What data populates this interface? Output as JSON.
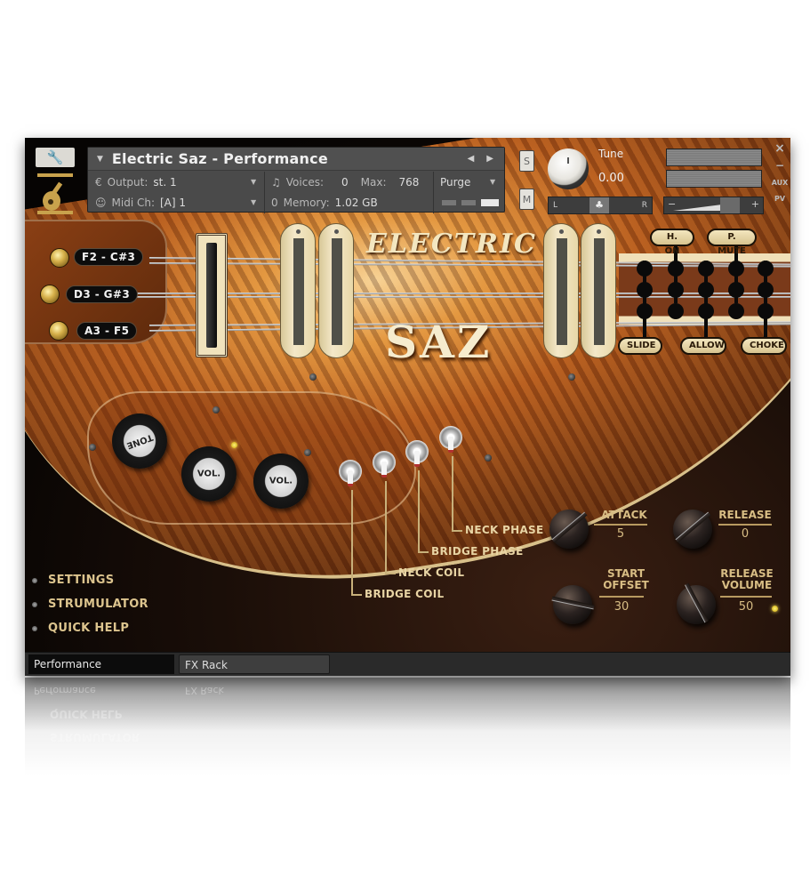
{
  "header": {
    "instrument_name": "Electric Saz - Performance",
    "output_label": "Output:",
    "output_value": "st. 1",
    "midi_label": "Midi Ch:",
    "midi_value": "[A]  1",
    "voices_label": "Voices:",
    "voices_value": "0",
    "max_label": "Max:",
    "max_value": "768",
    "memory_label": "Memory:",
    "memory_value": "1.02 GB",
    "purge_label": "Purge",
    "solo_label": "S",
    "mute_label": "M",
    "tune_label": "Tune",
    "tune_value": "0.00",
    "pan_left": "L",
    "pan_right": "R",
    "vol_minus": "−",
    "vol_plus": "+",
    "close_label": "×",
    "minimize_label": "−",
    "aux_label": "AUX",
    "pv_label": "PV",
    "icons": {
      "wrench": "wrench-icon",
      "instrument_logo": "saz-icon",
      "prev": "◀",
      "next": "▶",
      "caret": "▼",
      "output_icon": "€",
      "midi_icon": "☺",
      "voices_icon": "♫",
      "memory_icon": "0"
    }
  },
  "tunings": [
    {
      "label": "F2 - C#3"
    },
    {
      "label": "D3 - G#3"
    },
    {
      "label": "A3 - F5"
    }
  ],
  "logo": {
    "line1": "ELECTRIC",
    "line2": "SAZ"
  },
  "articulations": {
    "top": [
      "H. ON",
      "P. MUTE"
    ],
    "bottom": [
      "SLIDE",
      "ALLOW",
      "CHOKE"
    ]
  },
  "guitar_knobs": [
    {
      "label": "TONE"
    },
    {
      "label": "VOL."
    },
    {
      "label": "VOL."
    }
  ],
  "switches": [
    {
      "label": "BRIDGE COIL"
    },
    {
      "label": "NECK COIL"
    },
    {
      "label": "BRIDGE PHASE"
    },
    {
      "label": "NECK PHASE"
    }
  ],
  "envelope": [
    {
      "label": "ATTACK",
      "value": "5"
    },
    {
      "label": "RELEASE",
      "value": "0"
    },
    {
      "label": "START OFFSET",
      "value": "30"
    },
    {
      "label": "RELEASE VOLUME",
      "value": "50"
    }
  ],
  "menu": [
    {
      "label": "SETTINGS"
    },
    {
      "label": "STRUMULATOR"
    },
    {
      "label": "QUICK HELP"
    }
  ],
  "tabs": [
    {
      "label": "Performance",
      "active": true
    },
    {
      "label": "FX Rack",
      "active": false
    }
  ]
}
